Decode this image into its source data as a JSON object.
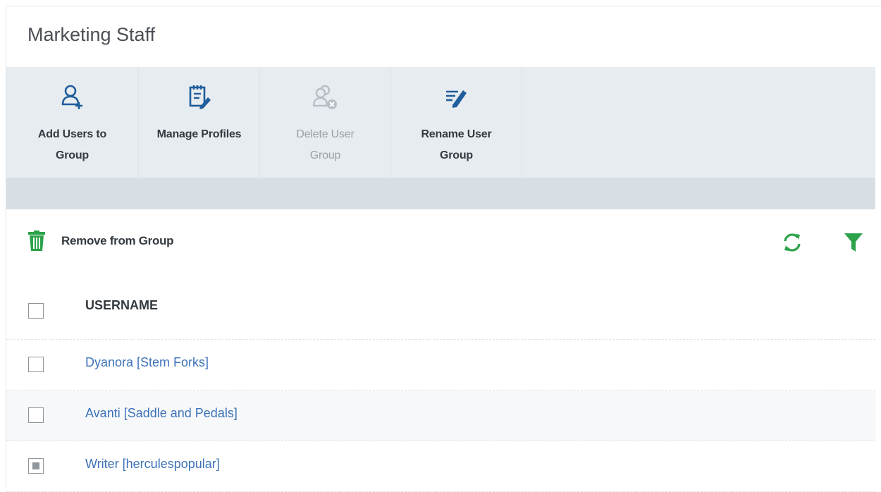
{
  "page": {
    "title": "Marketing Staff"
  },
  "toolbar": {
    "buttons": [
      {
        "line1": "Add Users to",
        "line2": "Group",
        "icon": "add-user-icon",
        "disabled": false
      },
      {
        "line1": "Manage Profiles",
        "line2": "",
        "icon": "manage-profiles-icon",
        "disabled": false
      },
      {
        "line1": "Delete User",
        "line2": "Group",
        "icon": "delete-group-icon",
        "disabled": true
      },
      {
        "line1": "Rename User",
        "line2": "Group",
        "icon": "rename-icon",
        "disabled": false
      }
    ]
  },
  "actions": {
    "remove_label": "Remove from Group",
    "remove_icon": "trash-icon",
    "refresh_icon": "refresh-icon",
    "filter_icon": "filter-icon",
    "accent_color": "#2ca24a"
  },
  "table": {
    "column_header": "USERNAME",
    "rows": [
      {
        "name": "Dyanora [Stem Forks]",
        "checked": false
      },
      {
        "name": "Avanti [Saddle and Pedals]",
        "checked": false
      },
      {
        "name": "Writer [herculespopular]",
        "checked": true
      }
    ]
  },
  "colors": {
    "link": "#3d72b8",
    "toolbar_bg": "#e7ecf0",
    "band_bg": "#d7dfe5",
    "primary_icon": "#1f5d9c",
    "disabled_icon": "#b7bec5"
  }
}
